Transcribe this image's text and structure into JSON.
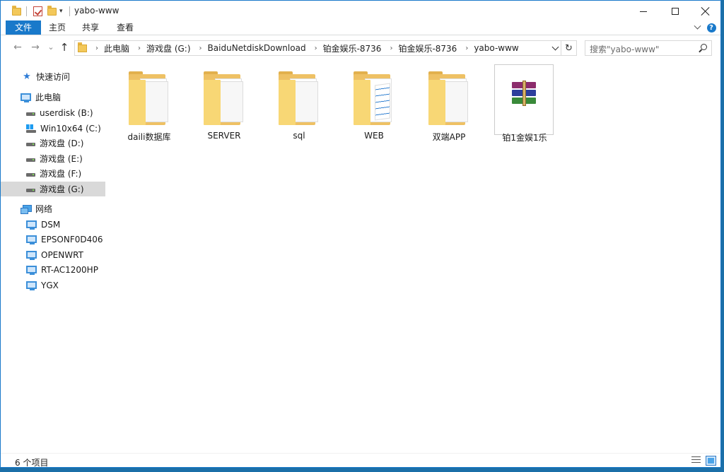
{
  "window": {
    "title": "yabo-www",
    "controls": {
      "minimize": "minimize",
      "maximize": "maximize",
      "close": "close"
    }
  },
  "ribbon": {
    "tabs": [
      {
        "label": "文件",
        "active": true
      },
      {
        "label": "主页"
      },
      {
        "label": "共享"
      },
      {
        "label": "查看"
      }
    ],
    "help_label": "?"
  },
  "address": {
    "breadcrumbs": [
      "此电脑",
      "游戏盘 (G:)",
      "BaiduNetdiskDownload",
      "铂金娱乐-8736",
      "铂金娱乐-8736",
      "yabo-www"
    ],
    "search_placeholder": "搜索\"yabo-www\""
  },
  "nav": {
    "back": "←",
    "forward": "→",
    "recent": "⌄",
    "up": "↑",
    "refresh": "↻"
  },
  "navpane": {
    "quick_access": "快速访问",
    "this_pc": "此电脑",
    "drives": [
      {
        "label": "userdisk (B:)",
        "icon": "drive-icon"
      },
      {
        "label": "Win10x64 (C:)",
        "icon": "windows-drive-icon"
      },
      {
        "label": "游戏盘 (D:)",
        "icon": "drive-icon"
      },
      {
        "label": "游戏盘 (E:)",
        "icon": "drive-icon"
      },
      {
        "label": "游戏盘 (F:)",
        "icon": "drive-icon"
      },
      {
        "label": "游戏盘 (G:)",
        "icon": "drive-icon",
        "selected": true
      }
    ],
    "network": "网络",
    "network_items": [
      "DSM",
      "EPSONF0D406",
      "OPENWRT",
      "RT-AC1200HP",
      "YGX"
    ]
  },
  "files": [
    {
      "name": "daili数据库",
      "type": "folder"
    },
    {
      "name": "SERVER",
      "type": "folder"
    },
    {
      "name": "sql",
      "type": "folder"
    },
    {
      "name": "WEB",
      "type": "folder"
    },
    {
      "name": "双端APP",
      "type": "folder"
    },
    {
      "name": "铂1金娱1乐",
      "type": "rar-archive"
    }
  ],
  "status": {
    "item_count": "6 个项目"
  },
  "colors": {
    "accent": "#1979ca",
    "folder": "#eec164",
    "selection": "#d9d9d9"
  }
}
